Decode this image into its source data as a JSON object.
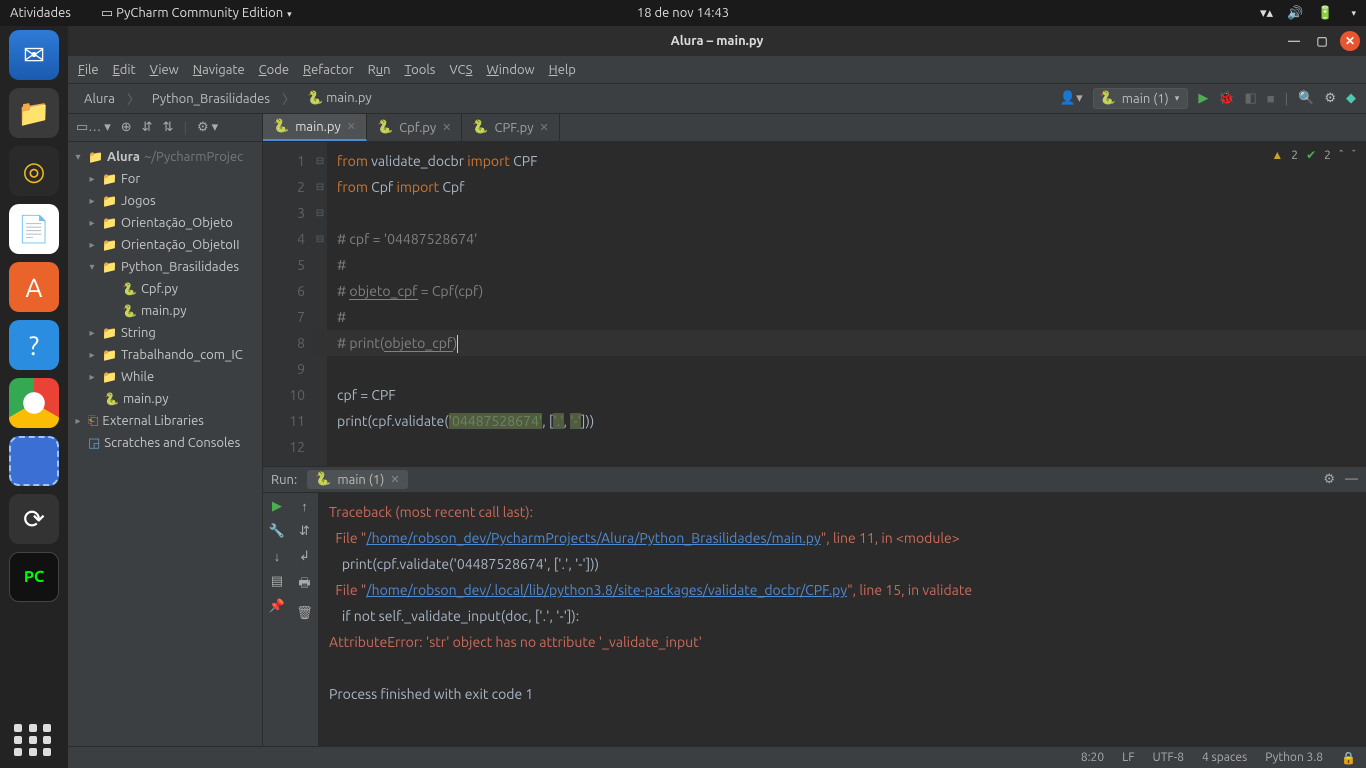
{
  "gnome": {
    "activities": "Atividades",
    "app_name": "PyCharm Community Edition",
    "datetime": "18 de nov  14:43"
  },
  "dock": {
    "pycharm_label": "PC"
  },
  "window": {
    "title": "Alura – main.py"
  },
  "menubar": [
    "File",
    "Edit",
    "View",
    "Navigate",
    "Code",
    "Refactor",
    "Run",
    "Tools",
    "VCS",
    "Window",
    "Help"
  ],
  "breadcrumbs": [
    "Alura",
    "Python_Brasilidades",
    "main.py"
  ],
  "run_config_name": "main (1)",
  "inspection": {
    "warn_count": "2",
    "ok_count": "2"
  },
  "tree": {
    "root": "Alura",
    "root_path": "~/PycharmProjec",
    "folders_l1": [
      "For",
      "Jogos",
      "Orientação_Objeto",
      "Orientação_ObjetoII",
      "Python_Brasilidades",
      "String",
      "Trabalhando_com_IC",
      "While"
    ],
    "python_bras_files": [
      "Cpf.py",
      "main.py"
    ],
    "root_file": "main.py",
    "ext_lib": "External Libraries",
    "scratches": "Scratches and Consoles"
  },
  "tabs": [
    {
      "name": "main.py",
      "active": true
    },
    {
      "name": "Cpf.py",
      "active": false
    },
    {
      "name": "CPF.py",
      "active": false
    }
  ],
  "line_numbers": [
    "1",
    "2",
    "3",
    "4",
    "5",
    "6",
    "7",
    "8",
    "9",
    "10",
    "11",
    "12"
  ],
  "code": {
    "l1": {
      "kw1": "from",
      "mod": " validate_docbr ",
      "kw2": "import",
      "cls": " CPF"
    },
    "l2": {
      "kw1": "from",
      "mod": " Cpf ",
      "kw2": "import",
      "cls": " Cpf"
    },
    "l4": "# cpf = '04487528674'",
    "l5": "#",
    "l6_pre": "# ",
    "l6_udl": "objeto_cpf",
    "l6_post": " = Cpf(cpf)",
    "l7": "#",
    "l8_pre": "# print(",
    "l8_udl": "objeto_cpf",
    "l8_post": ")",
    "l10": "cpf = CPF",
    "l11_pre": "print(cpf.validate(",
    "l11_s1": "'04487528674'",
    "l11_mid": ", [",
    "l11_s2": "'.'",
    "l11_mid2": ", ",
    "l11_s3": "'-'",
    "l11_post": "]))"
  },
  "run_panel": {
    "label": "Run:",
    "tab": "main (1)",
    "l1": "Traceback (most recent call last):",
    "l2_pre": "  File \"",
    "l2_link": "/home/robson_dev/PycharmProjects/Alura/Python_Brasilidades/main.py",
    "l2_post": "\", line 11, in <module>",
    "l3": "    print(cpf.validate('04487528674', ['.', '-']))",
    "l4_pre": "  File \"",
    "l4_link": "/home/robson_dev/.local/lib/python3.8/site-packages/validate_docbr/CPF.py",
    "l4_post": "\", line 15, in validate",
    "l5": "    if not self._validate_input(doc, ['.', '-']):",
    "l6": "AttributeError: 'str' object has no attribute '_validate_input'",
    "l8": "Process finished with exit code 1"
  },
  "status": {
    "pos": "8:20",
    "le": "LF",
    "enc": "UTF-8",
    "indent": "4 spaces",
    "interp": "Python 3.8"
  }
}
